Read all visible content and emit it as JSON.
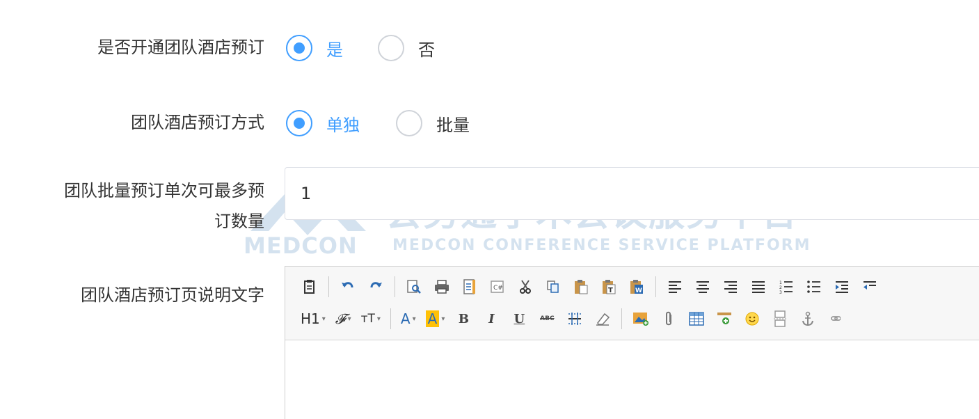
{
  "form": {
    "group_hotel_booking": {
      "label": "是否开通团队酒店预订",
      "options": [
        {
          "label": "是",
          "checked": true
        },
        {
          "label": "否",
          "checked": false
        }
      ]
    },
    "group_booking_mode": {
      "label": "团队酒店预订方式",
      "options": [
        {
          "label": "单独",
          "checked": true
        },
        {
          "label": "批量",
          "checked": false
        }
      ]
    },
    "batch_max": {
      "label_line1": "团队批量预订单次可最多预",
      "label_line2": "订数量",
      "value": "1"
    },
    "description": {
      "label": "团队酒店预订页说明文字"
    }
  },
  "editor": {
    "heading_dropdown": "H1",
    "font_dropdown": "𝓕",
    "fontsize_dropdown": "тT",
    "fontcolor_dropdown": "A",
    "bgcolor_dropdown": "A",
    "bold": "B",
    "italic": "I",
    "underline": "U",
    "strike": "ABC"
  },
  "watermark": {
    "chinese": "会务通学术会议服务平台",
    "english": "MEDCON CONFERENCE SERVICE PLATFORM",
    "logo": "MEDCON"
  },
  "colors": {
    "accent": "#409eff",
    "text": "#333333",
    "border": "#dcdfe6"
  }
}
